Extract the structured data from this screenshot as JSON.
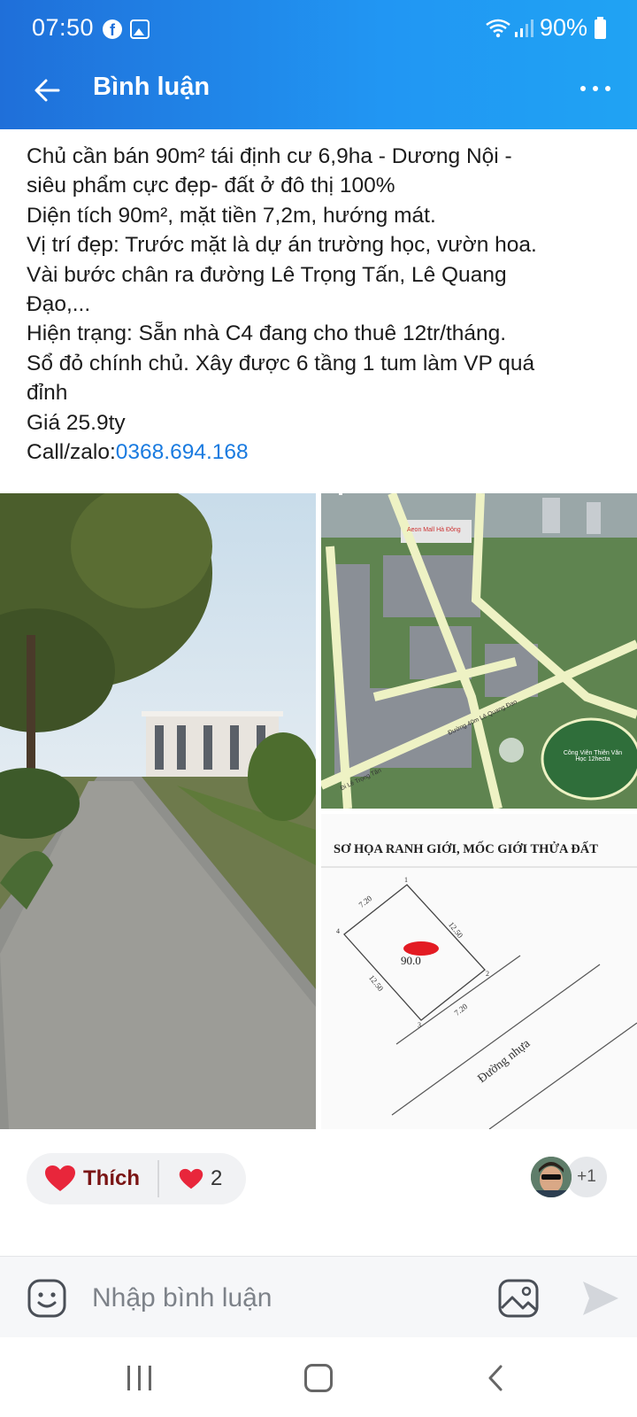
{
  "status_bar": {
    "time": "07:50",
    "battery": "90%",
    "icons": [
      "facebook-icon",
      "gallery-notification-icon",
      "wifi-icon",
      "signal-icon",
      "battery-icon"
    ]
  },
  "header": {
    "title": "Bình luận",
    "icons": [
      "back-arrow-icon",
      "more-options-icon"
    ],
    "color": "#2196f3"
  },
  "post": {
    "lines": [
      "Chủ cần bán 90m² tái định cư 6,9ha - Dương Nội -",
      "siêu phẩm cực đẹp- đất ở đô thị 100%",
      "Diện tích 90m², mặt tiền 7,2m, hướng mát.",
      "Vị trí đẹp: Trước mặt là dự án trường học, vườn hoa.",
      "Vài bước chân ra đường Lê Trọng Tấn, Lê Quang",
      "Đạo,...",
      "Hiện trạng: Sẵn nhà C4 đang cho thuê 12tr/tháng.",
      "Sổ đỏ chính chủ. Xây được 6 tầng 1 tum làm VP quá",
      "đỉnh",
      "Giá 25.9ty"
    ],
    "contact_label": "Call/zalo:",
    "phone": "0368.694.168",
    "link_color": "#1a7be0"
  },
  "images": {
    "map_labels": {
      "aeon": "Aeon Mall Hà Đông",
      "park": "Công Viên Thiên Văn Học 12hecta",
      "road1": "Đường 40m Lê Quang Đạo",
      "road2": "Đi Lê Trọng Tấn"
    },
    "plan": {
      "title": "SƠ HỌA RANH GIỚI, MỐC GIỚI THỬA ĐẤT",
      "area": "90.0",
      "edge_top": "7.20",
      "edge_right": "12.50",
      "edge_left": "12.50",
      "edge_bottom": "7.20",
      "corner_1": "1",
      "corner_2": "2",
      "corner_3": "3",
      "corner_4": "4",
      "road": "Đường nhựa"
    }
  },
  "reactions": {
    "like_label": "Thích",
    "count": "2",
    "others": "+1",
    "heart_color": "#e8263b"
  },
  "comment_bar": {
    "placeholder": "Nhập bình luận"
  },
  "nav": {
    "buttons": [
      "recent-apps",
      "home",
      "back"
    ]
  }
}
